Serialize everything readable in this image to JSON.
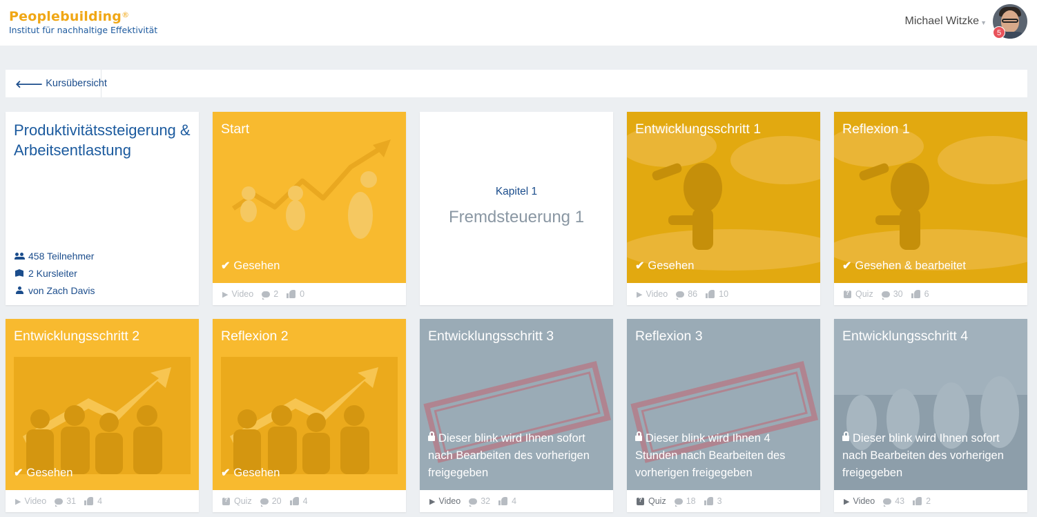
{
  "header": {
    "brand_name": "Peoplebuilding",
    "brand_reg": "®",
    "brand_tagline": "Institut für nachhaltige Effektivität",
    "user_name": "Michael Witzke",
    "notification_count": "5"
  },
  "nav": {
    "back_label": "Kursübersicht"
  },
  "course": {
    "title": "Produktivitätssteigerung & Arbeitsentlastung",
    "participants": "458 Teilnehmer",
    "leaders": "2 Kursleiter",
    "author": "von Zach Davis"
  },
  "chapter": {
    "label": "Kapitel 1",
    "name": "Fremdsteuerung 1"
  },
  "cards": [
    {
      "title": "Start",
      "status": "Gesehen",
      "type": "Video",
      "comments": "2",
      "likes": "0",
      "color": "#f8ba2f"
    },
    {
      "title": "Entwicklungsschritt 1",
      "status": "Gesehen",
      "type": "Video",
      "comments": "86",
      "likes": "10",
      "color": "#e2a910"
    },
    {
      "title": "Reflexion 1",
      "status": "Gesehen & bearbeitet",
      "type": "Quiz",
      "comments": "30",
      "likes": "6",
      "color": "#e2a910"
    },
    {
      "title": "Entwicklungsschritt 2",
      "status": "Gesehen",
      "type": "Video",
      "comments": "31",
      "likes": "4",
      "color": "#f8ba2f"
    },
    {
      "title": "Reflexion 2",
      "status": "Gesehen",
      "type": "Quiz",
      "comments": "20",
      "likes": "4",
      "color": "#f8ba2f"
    },
    {
      "title": "Entwicklungsschritt 3",
      "lock_text": "Dieser blink wird Ihnen sofort nach Bearbeiten des vorherigen freigegeben",
      "type": "Video",
      "comments": "32",
      "likes": "4",
      "color": "#9aabb6"
    },
    {
      "title": "Reflexion 3",
      "lock_text": "Dieser blink wird Ihnen 4 Stunden nach Bearbeiten des vorherigen freigegeben",
      "type": "Quiz",
      "comments": "18",
      "likes": "3",
      "color": "#9aabb6"
    },
    {
      "title": "Entwicklungsschritt 4",
      "lock_text": "Dieser blink wird Ihnen sofort nach Bearbeiten des vorherigen freigegeben",
      "type": "Video",
      "comments": "43",
      "likes": "2",
      "color": "#8c9da9"
    }
  ]
}
